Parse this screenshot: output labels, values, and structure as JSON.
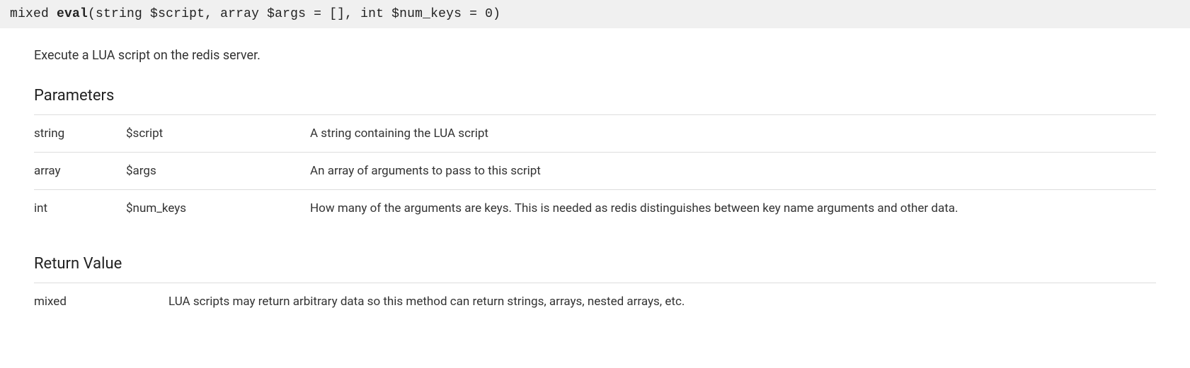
{
  "signature": {
    "return_type": "mixed",
    "method_name": "eval",
    "params_text": "(string $script, array $args = [], int $num_keys = 0)"
  },
  "description": "Execute a LUA script on the redis server.",
  "parameters_title": "Parameters",
  "parameters": [
    {
      "type": "string",
      "name": "$script",
      "desc": "A string containing the LUA script"
    },
    {
      "type": "array",
      "name": "$args",
      "desc": "An array of arguments to pass to this script"
    },
    {
      "type": "int",
      "name": "$num_keys",
      "desc": "How many of the arguments are keys. This is needed as redis distinguishes between key name arguments and other data."
    }
  ],
  "return_title": "Return Value",
  "return_value": {
    "type": "mixed",
    "desc": "LUA scripts may return arbitrary data so this method can return strings, arrays, nested arrays, etc."
  }
}
